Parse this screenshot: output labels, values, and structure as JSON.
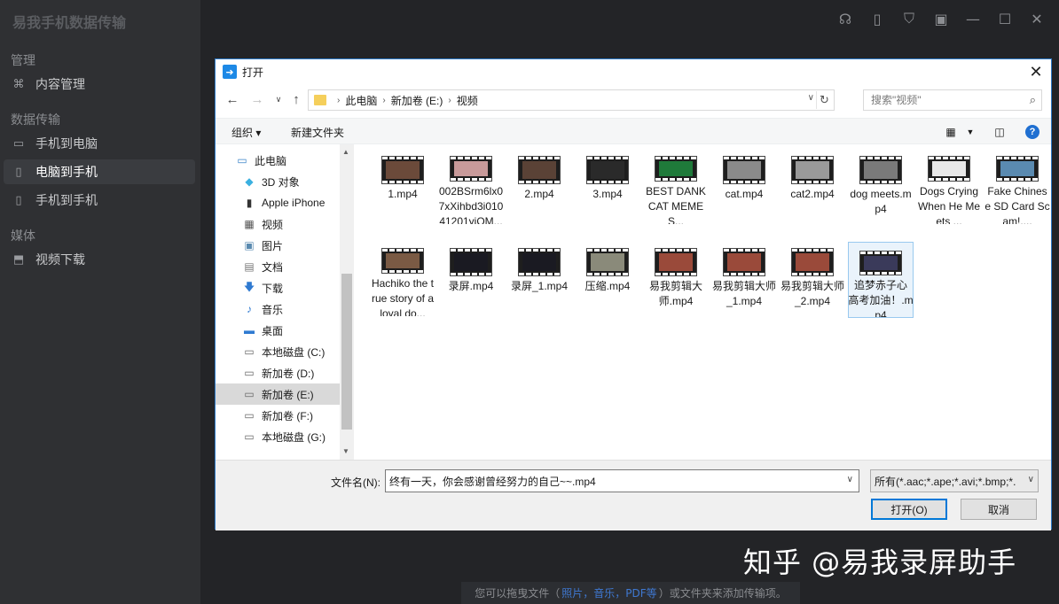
{
  "app": {
    "title": "易我手机数据传输",
    "sidebar": {
      "sections": [
        {
          "label": "管理"
        },
        {
          "label": "数据传输"
        },
        {
          "label": "媒体"
        }
      ],
      "items": [
        {
          "label": "内容管理",
          "icon": "grid-icon"
        },
        {
          "label": "手机到电脑",
          "icon": "phone-to-pc-icon"
        },
        {
          "label": "电脑到手机",
          "icon": "pc-to-phone-icon",
          "active": true
        },
        {
          "label": "手机到手机",
          "icon": "phone-to-phone-icon"
        },
        {
          "label": "视频下载",
          "icon": "video-download-icon"
        }
      ]
    },
    "drop_hint": {
      "prefix": "您可以拖曳文件（",
      "links": "照片，音乐，PDF等",
      "suffix": "）或文件夹来添加传输项。"
    },
    "watermark": "知乎 @易我录屏助手"
  },
  "dialog": {
    "title": "打开",
    "breadcrumbs": [
      "此电脑",
      "新加卷 (E:)",
      "视频"
    ],
    "search_placeholder": "搜索\"视频\"",
    "organize_label": "组织 ▾",
    "new_folder_label": "新建文件夹",
    "help_label": "?",
    "tree": [
      {
        "label": "此电脑",
        "icon": "computer-icon"
      },
      {
        "label": "3D 对象",
        "icon": "cube-icon"
      },
      {
        "label": "Apple iPhone",
        "icon": "iphone-icon"
      },
      {
        "label": "视频",
        "icon": "video-folder-icon"
      },
      {
        "label": "图片",
        "icon": "picture-folder-icon"
      },
      {
        "label": "文档",
        "icon": "document-folder-icon"
      },
      {
        "label": "下载",
        "icon": "download-arrow-icon"
      },
      {
        "label": "音乐",
        "icon": "music-note-icon"
      },
      {
        "label": "桌面",
        "icon": "desktop-icon"
      },
      {
        "label": "本地磁盘 (C:)",
        "icon": "drive-icon"
      },
      {
        "label": "新加卷 (D:)",
        "icon": "drive-icon"
      },
      {
        "label": "新加卷 (E:)",
        "icon": "drive-icon",
        "selected": true
      },
      {
        "label": "新加卷 (F:)",
        "icon": "drive-icon"
      },
      {
        "label": "本地磁盘 (G:)",
        "icon": "drive-icon"
      }
    ],
    "files": [
      {
        "name": "1.mp4",
        "color": "#6b4a3a"
      },
      {
        "name": "002BSrm6lx07xXihbd3i01041201yjQM...",
        "color": "#c89a9a"
      },
      {
        "name": "2.mp4",
        "color": "#5a4236"
      },
      {
        "name": "3.mp4",
        "color": "#2a2a2a"
      },
      {
        "name": "BEST DANK CAT MEMES...",
        "color": "#1f7a3a"
      },
      {
        "name": "cat.mp4",
        "color": "#8a8a8a"
      },
      {
        "name": "cat2.mp4",
        "color": "#9a9a9a"
      },
      {
        "name": "dog meets.mp4",
        "color": "#7a7a7a"
      },
      {
        "name": "Dogs Crying When He Meets ...",
        "color": "#e8e8e8"
      },
      {
        "name": "Fake Chinese SD Card Scam!....",
        "color": "#5a8ab0"
      },
      {
        "name": "Hachiko the true story of a loyal do...",
        "color": "#7a5a44"
      },
      {
        "name": "录屏.mp4",
        "color": "#1a1a22"
      },
      {
        "name": "录屏_1.mp4",
        "color": "#1a1a22"
      },
      {
        "name": "压缩.mp4",
        "color": "#8a8a7a"
      },
      {
        "name": "易我剪辑大师.mp4",
        "color": "#9a4a3a"
      },
      {
        "name": "易我剪辑大师_1.mp4",
        "color": "#9a4a3a"
      },
      {
        "name": "易我剪辑大师_2.mp4",
        "color": "#9a4a3a"
      },
      {
        "name": "追梦赤子心 高考加油！.mp4",
        "color": "#3a3a5a",
        "selected": true
      }
    ],
    "filename_label": "文件名(N):",
    "filename_value": "终有一天，你会感谢曾经努力的自己~~.mp4",
    "filetype_value": "所有(*.aac;*.ape;*.avi;*.bmp;*.",
    "open_label": "打开(O)",
    "cancel_label": "取消"
  }
}
